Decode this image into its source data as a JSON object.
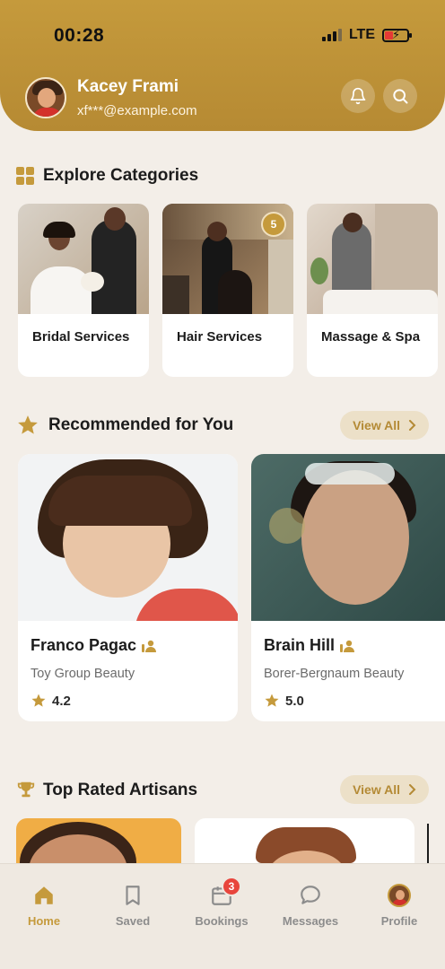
{
  "status_bar": {
    "time": "00:28",
    "network": "LTE"
  },
  "user": {
    "name": "Kacey Frami",
    "email": "xf***@example.com"
  },
  "categories": {
    "title": "Explore Categories",
    "items": [
      {
        "label": "Bridal Services"
      },
      {
        "label": "Hair Services",
        "badge": "5"
      },
      {
        "label": "Massage & Spa"
      }
    ]
  },
  "recommended": {
    "title": "Recommended for You",
    "view_all": "View All",
    "items": [
      {
        "name": "Franco Pagac",
        "salon": "Toy Group Beauty",
        "rating": "4.2"
      },
      {
        "name": "Brain Hill",
        "salon": "Borer-Bergnaum Beauty",
        "rating": "5.0"
      }
    ]
  },
  "top_rated": {
    "title": "Top Rated Artisans",
    "view_all": "View All"
  },
  "nav": {
    "items": [
      {
        "label": "Home",
        "icon": "home-icon",
        "active": true
      },
      {
        "label": "Saved",
        "icon": "bookmark-icon"
      },
      {
        "label": "Bookings",
        "icon": "calendar-icon",
        "badge": "3"
      },
      {
        "label": "Messages",
        "icon": "chat-icon"
      },
      {
        "label": "Profile",
        "icon": "avatar"
      }
    ]
  },
  "colors": {
    "accent": "#c59a3c",
    "background": "#f3eee8",
    "badge": "#e8453c"
  }
}
